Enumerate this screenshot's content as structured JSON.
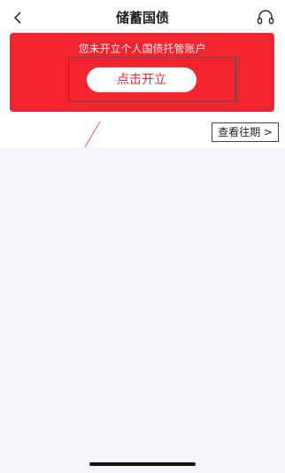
{
  "header": {
    "title": "储蓄国债",
    "back_icon": "chevron-left-icon",
    "support_icon": "headset-icon"
  },
  "account_card": {
    "message": "您未开立个人国债托管账户",
    "open_button_label": "点击开立",
    "background_color": "#f3242f"
  },
  "history_button_label": "查看往期 >"
}
